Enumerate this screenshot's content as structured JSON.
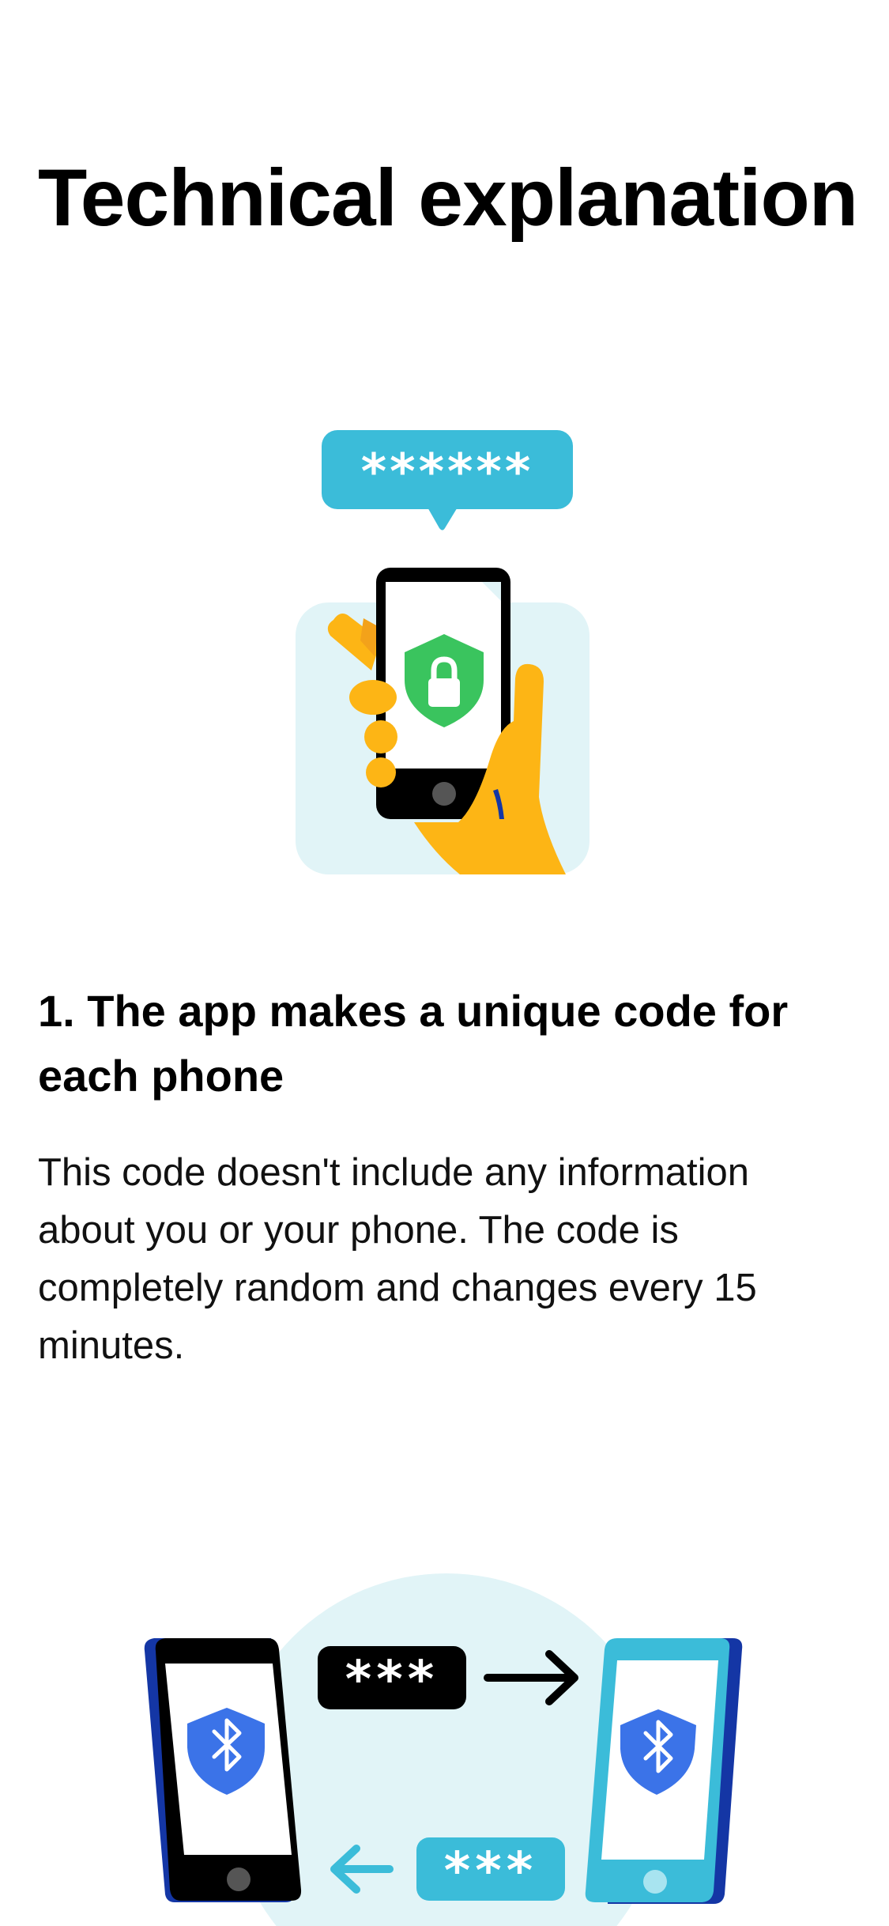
{
  "page": {
    "title": "Technical explanation"
  },
  "sections": [
    {
      "heading": "1. The app makes a unique code for each phone",
      "body": "This code doesn't include any information about you or your phone. The code is completely random and changes every 15 minutes."
    }
  ],
  "illustrations": {
    "code_bubble_text": "******",
    "exchange_code_outgoing": "***",
    "exchange_code_incoming": "***"
  },
  "colors": {
    "accent_cyan": "#3bbcd9",
    "light_cyan_bg": "#e1f4f7",
    "hand_yellow": "#fdb515",
    "shield_green": "#3ac45e",
    "shield_blue": "#3b73e8",
    "dark_blue": "#1436a5"
  },
  "icons": [
    "speech-bubble-icon",
    "phone-icon",
    "lock-shield-icon",
    "hand-icon",
    "bluetooth-shield-icon",
    "arrow-right-icon",
    "arrow-left-icon"
  ]
}
